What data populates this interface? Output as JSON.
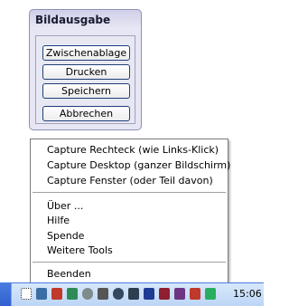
{
  "panel": {
    "title": "Bildausgabe",
    "buttons": [
      "Zwischenablage",
      "Drucken",
      "Speichern",
      "Abbrechen"
    ]
  },
  "menu": {
    "items": [
      "Capture Rechteck (wie Links-Klick)",
      "Capture Desktop (ganzer Bildschirm)",
      "Capture Fenster (oder Teil davon)",
      "Über ...",
      "Hilfe",
      "Spende",
      "Weitere Tools",
      "Beenden"
    ]
  },
  "taskbar": {
    "clock": "15:06",
    "tray_icons": [
      {
        "name": "capture-tool-icon",
        "color": "#ffffff"
      },
      {
        "name": "network-icon",
        "color": "#3a6ea5"
      },
      {
        "name": "antivirus-icon",
        "color": "#c0392b"
      },
      {
        "name": "security-check-icon",
        "color": "#2e8b57"
      },
      {
        "name": "app-icon",
        "color": "#7f8c8d"
      },
      {
        "name": "settings-icon",
        "color": "#555555"
      },
      {
        "name": "clock-icon",
        "color": "#34495e"
      },
      {
        "name": "messenger-icon",
        "color": "#2c3e50"
      },
      {
        "name": "tool-icon",
        "color": "#1f3a93"
      },
      {
        "name": "update-icon",
        "color": "#8e1f2f"
      },
      {
        "name": "shield-icon",
        "color": "#6c3483"
      },
      {
        "name": "volume-icon",
        "color": "#27ae60"
      }
    ]
  }
}
